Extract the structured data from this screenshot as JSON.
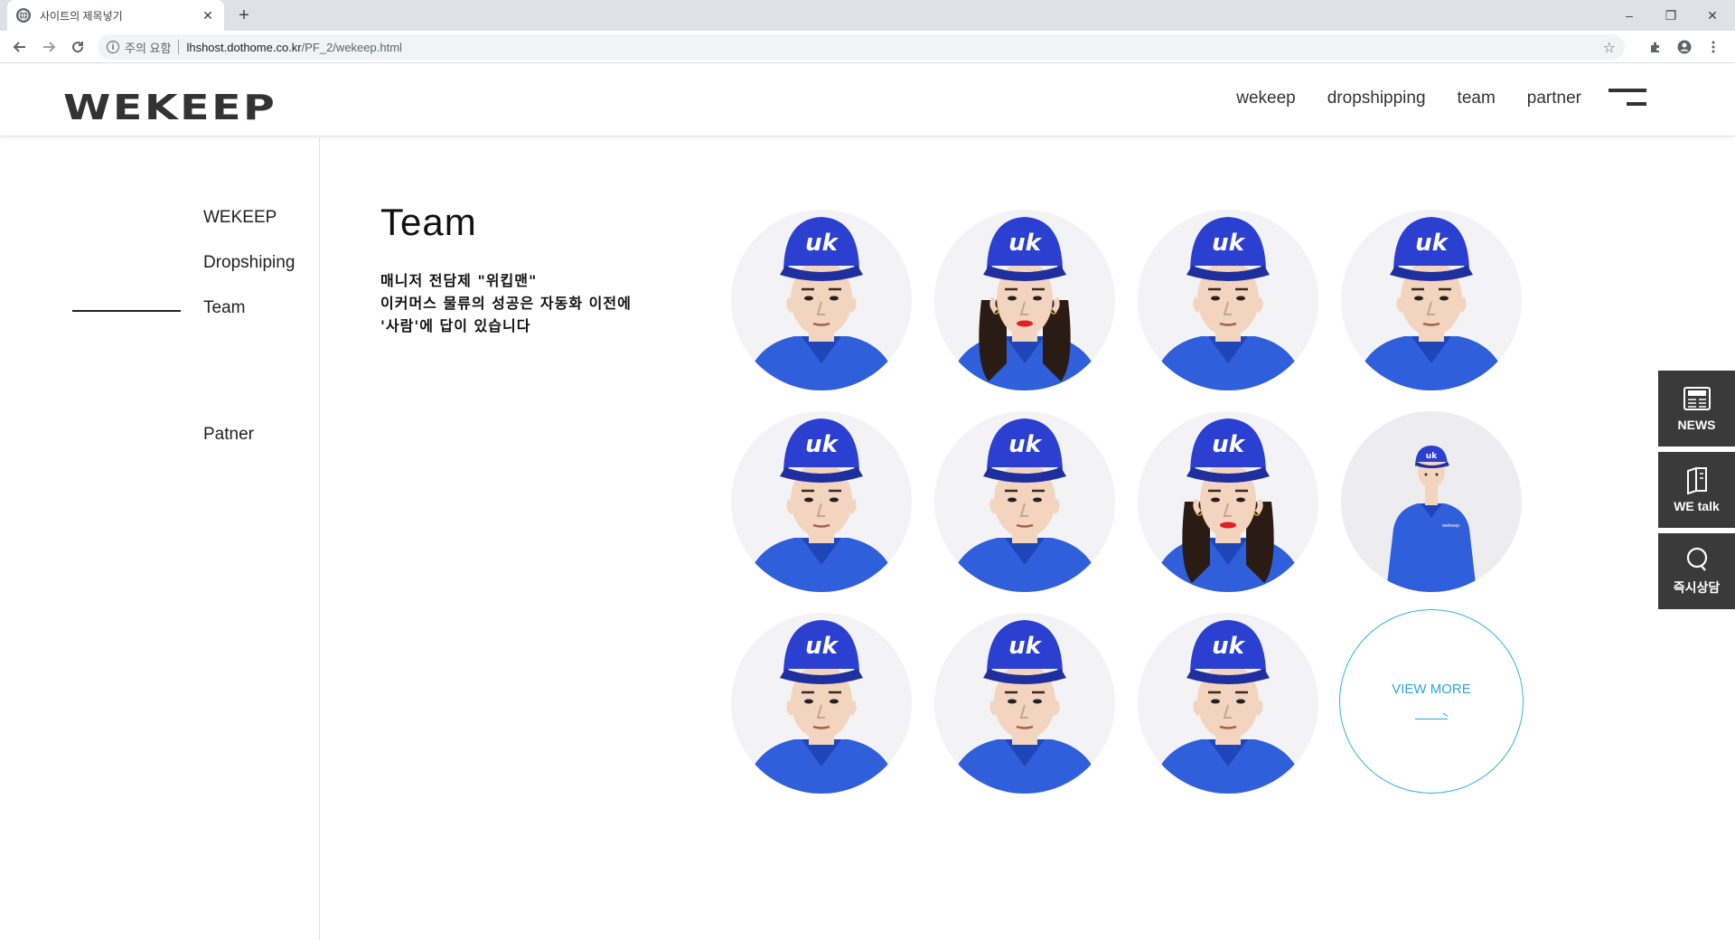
{
  "browser": {
    "tab_title": "사이트의 제목넣기",
    "tab_close": "✕",
    "new_tab": "+",
    "security_label": "주의 요함",
    "url_host": "lhshost.dothome.co.kr",
    "url_path": "/PF_2/wekeep.html",
    "window_min": "–",
    "window_restore": "❐",
    "window_close": "✕"
  },
  "header": {
    "logo": "WEKEEP",
    "nav": [
      "wekeep",
      "dropshipping",
      "team",
      "partner"
    ]
  },
  "sidebar": {
    "items": [
      "WEKEEP",
      "Dropshiping",
      "Team",
      "Patner"
    ],
    "active": "Team"
  },
  "section": {
    "title": "Team",
    "desc_lines": [
      "매니저 전담제 \"위킵맨\"",
      "이커머스 물류의 성공은 자동화 이전에",
      "'사람'에 답이 있습니다"
    ]
  },
  "team": {
    "members": [
      {
        "gender": "m"
      },
      {
        "gender": "f"
      },
      {
        "gender": "m"
      },
      {
        "gender": "m"
      },
      {
        "gender": "m"
      },
      {
        "gender": "m"
      },
      {
        "gender": "f"
      },
      {
        "gender": "full"
      },
      {
        "gender": "m"
      },
      {
        "gender": "m"
      },
      {
        "gender": "m"
      }
    ],
    "cap_logo": "uk",
    "shirt_logo": "wekeep",
    "view_more": "VIEW MORE",
    "colors": {
      "cap": "#2b3fd0",
      "shirt": "#2f5fdb",
      "skin": "#f2d4bf",
      "hair": "#2a1c14",
      "lips": "#e02020"
    }
  },
  "quick_menu": [
    {
      "label": "NEWS",
      "icon": "newspaper-icon"
    },
    {
      "label": "WE talk",
      "icon": "book-icon"
    },
    {
      "label": "즉시상담",
      "icon": "chat-icon"
    }
  ]
}
